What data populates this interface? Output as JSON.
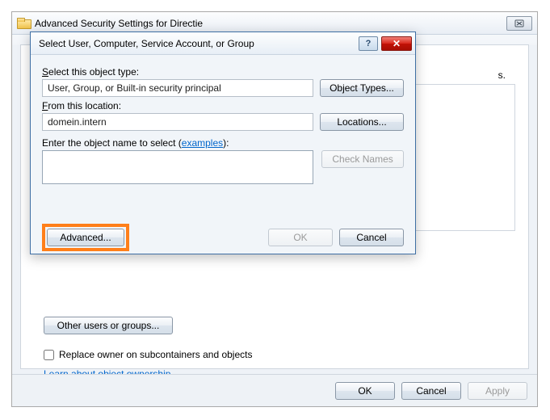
{
  "parent": {
    "title": "Advanced Security Settings for Directie",
    "truncated_text": "s.",
    "other_users_btn": "Other users or groups...",
    "replace_label": "Replace owner on subcontainers and objects",
    "learn_link": "Learn about object ownership",
    "ok": "OK",
    "cancel": "Cancel",
    "apply": "Apply"
  },
  "dialog": {
    "title": "Select User, Computer, Service Account, or Group",
    "help_glyph": "?",
    "close_glyph": "✕",
    "object_type_label": "Select this object type:",
    "object_type_value": "User, Group, or Built-in security principal",
    "object_types_btn": "Object Types...",
    "location_label": "From this location:",
    "location_value": "domein.intern",
    "locations_btn": "Locations...",
    "enter_label_prefix": "Enter the object name to select (",
    "examples_text": "examples",
    "enter_label_suffix": "):",
    "names_value": "",
    "check_names_btn": "Check Names",
    "advanced_btn": "Advanced...",
    "ok": "OK",
    "cancel": "Cancel"
  }
}
